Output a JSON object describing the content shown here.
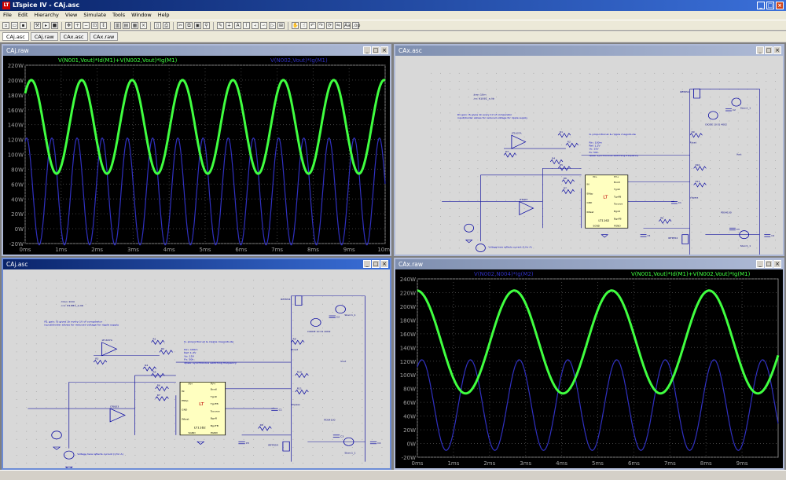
{
  "app": {
    "title": "LTspice IV - CAj.asc"
  },
  "menu": [
    "File",
    "Edit",
    "Hierarchy",
    "View",
    "Simulate",
    "Tools",
    "Window",
    "Help"
  ],
  "tabs": [
    "CAj.asc",
    "CAj.raw",
    "CAx.asc",
    "CAx.raw"
  ],
  "windows": {
    "plot1": {
      "title": "CAj.raw"
    },
    "sch1": {
      "title": "CAx.asc"
    },
    "sch2": {
      "title": "CAj.asc"
    },
    "plot2": {
      "title": "CAx.raw"
    }
  },
  "plot1_labels": {
    "trace1": "V(N001,Vout)*Id(M1)+V(N002,Vout)*Ig(M1)",
    "trace2": "V(N002,Vout)*Ig(M1)"
  },
  "plot2_labels": {
    "trace1": "V(N001,Vout)*Id(M1)+V(N002,Vout)*Ig(M1)",
    "trace2": "V(N002,N004)*Ig(M2)"
  },
  "schematic": {
    "notes": [
      ".tran 10m",
      ".inc lt1081_a.lib"
    ],
    "gain_note1": "R1 gain: IS gives 1k every 1V of comparator",
    "gain_note2": "input/divider allows for reduced voltage for ripple supply",
    "prop_note": "IL proportional & ripple magnitude",
    "params": [
      "Rin: 100m",
      "Ref: 1.2V",
      "Vo: 15V",
      "Fs: 50k",
      "dpsw: synchronous switching frequency"
    ],
    "ic_name": "LT1162",
    "ic_pins_left": [
      "IN",
      "ENbp",
      "GND",
      "INtest"
    ],
    "ic_pins_right": [
      "Bootl",
      "TgnR",
      "TgnFB",
      "Tsource",
      "BgnR",
      "BgnFB"
    ],
    "ic_top": [
      "IN+",
      "PV+"
    ],
    "ic_bottom": [
      "SGND",
      "PGND"
    ],
    "opamp": "LT1637A",
    "mosfets": [
      "IRFP054",
      "IRFP054"
    ],
    "diode": "PDS4100",
    "diode2": "DIODE 10 01 4002",
    "vsource": "Sbsrc1_1",
    "res_labels": [
      "R3",
      "R4",
      "R5",
      "R6",
      "R7",
      "R8",
      "R9",
      "R1",
      "R2",
      "R10",
      "R11"
    ],
    "cap_labels": [
      "C1",
      "C2",
      "C3",
      "C4",
      "C5"
    ],
    "voltage_note": "Voltage here reflects current (1 for A)",
    "bpass": "Vbpass",
    "rload": "Rload",
    "vout": "Vout"
  },
  "plot1": {
    "y_ticks": [
      "220W",
      "200W",
      "180W",
      "160W",
      "140W",
      "120W",
      "100W",
      "80W",
      "60W",
      "40W",
      "20W",
      "0W",
      "-20W"
    ],
    "x_ticks": [
      "0ms",
      "1ms",
      "2ms",
      "3ms",
      "4ms",
      "5ms",
      "6ms",
      "7ms",
      "8ms",
      "9ms",
      "10ms"
    ]
  },
  "plot2": {
    "y_ticks": [
      "240W",
      "220W",
      "200W",
      "180W",
      "160W",
      "140W",
      "120W",
      "100W",
      "80W",
      "60W",
      "40W",
      "20W",
      "0W",
      "-20W"
    ],
    "x_ticks": [
      "0ms",
      "1ms",
      "2ms",
      "3ms",
      "4ms",
      "5ms",
      "6ms",
      "7ms",
      "8ms",
      "9ms"
    ]
  },
  "chart_data": [
    {
      "type": "line",
      "title": "",
      "xlabel": "",
      "ylabel": "",
      "xlim": [
        0,
        10
      ],
      "ylim": [
        -20,
        220
      ],
      "series": [
        {
          "name": "V(N001,Vout)*Id(M1)+V(N002,Vout)*Ig(M1)",
          "color": "#40ff40",
          "mean": 137,
          "amplitude": 63,
          "period_ms": 1.4,
          "phase": 0.8
        },
        {
          "name": "V(N002,Vout)*Ig(M1)",
          "color": "#3030c0",
          "mean": 50,
          "amplitude": 72,
          "period_ms": 0.7,
          "phase": 1.2
        }
      ]
    },
    {
      "type": "line",
      "title": "",
      "xlabel": "",
      "ylabel": "",
      "xlim": [
        0,
        10
      ],
      "ylim": [
        -20,
        240
      ],
      "series": [
        {
          "name": "V(N001,Vout)*Id(M1)+V(N002,Vout)*Ig(M1)",
          "color": "#40ff40",
          "mean": 148,
          "amplitude": 75,
          "period_ms": 2.7,
          "phase": 1.6
        },
        {
          "name": "V(N002,N004)*Ig(M2)",
          "color": "#3030c0",
          "mean": 56,
          "amplitude": 66,
          "period_ms": 1.35,
          "phase": 1.0
        }
      ]
    }
  ]
}
